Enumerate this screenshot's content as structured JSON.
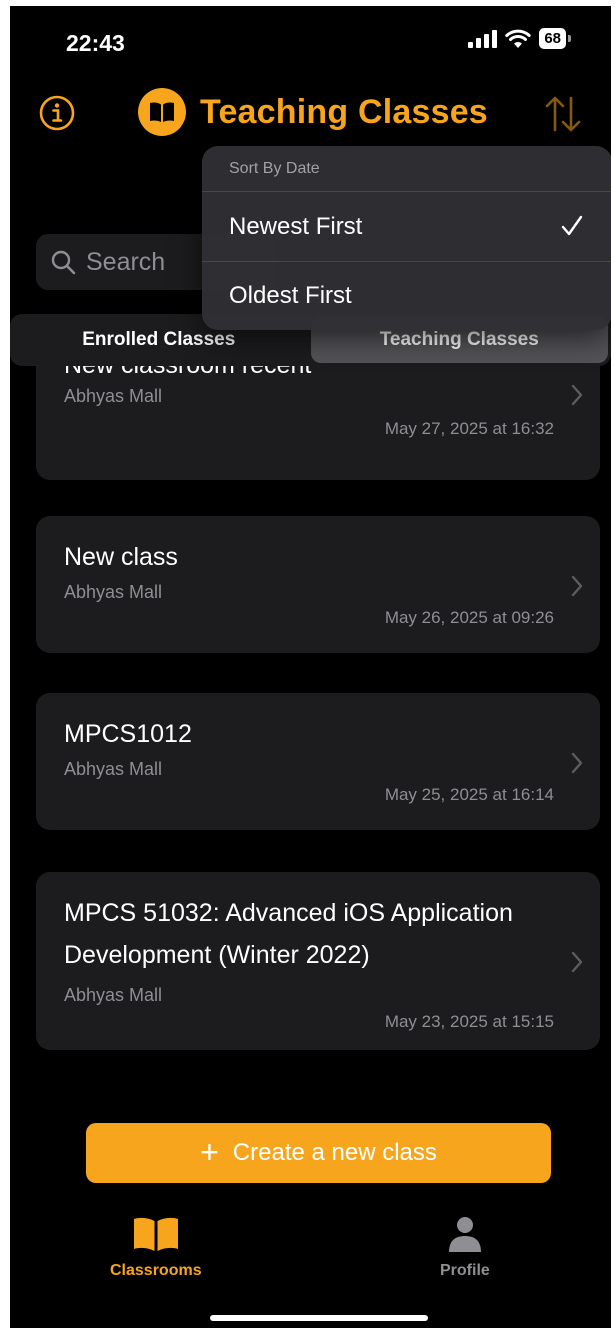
{
  "status_bar": {
    "time": "22:43",
    "battery": "68"
  },
  "header": {
    "title": "Teaching Classes"
  },
  "search": {
    "placeholder": "Search"
  },
  "segments": [
    {
      "label": "Enrolled Classes",
      "selected": false
    },
    {
      "label": "Teaching Classes",
      "selected": true
    }
  ],
  "sort_menu": {
    "header": "Sort By Date",
    "items": [
      {
        "label": "Newest First",
        "checked": true
      },
      {
        "label": "Oldest First",
        "checked": false
      }
    ]
  },
  "classes": [
    {
      "title": "New classroom recent",
      "owner": "Abhyas Mall",
      "date": "May 27, 2025 at 16:32"
    },
    {
      "title": "New class",
      "owner": "Abhyas Mall",
      "date": "May 26, 2025 at 09:26"
    },
    {
      "title": "MPCS1012",
      "owner": "Abhyas Mall",
      "date": "May 25, 2025 at 16:14"
    },
    {
      "title": "MPCS 51032: Advanced iOS Application",
      "title_line2": "Development (Winter 2022)",
      "owner": "Abhyas Mall",
      "date": "May 23, 2025 at 15:15"
    }
  ],
  "create_button": {
    "icon": "+",
    "label": "Create a new class"
  },
  "tab_bar": [
    {
      "label": "Classrooms",
      "icon": "book-icon",
      "active": true
    },
    {
      "label": "Profile",
      "icon": "person-icon",
      "active": false
    }
  ],
  "colors": {
    "accent": "#f7a51c",
    "background": "#000000",
    "card": "#1c1c1e",
    "secondary_text": "#8e8e93"
  }
}
